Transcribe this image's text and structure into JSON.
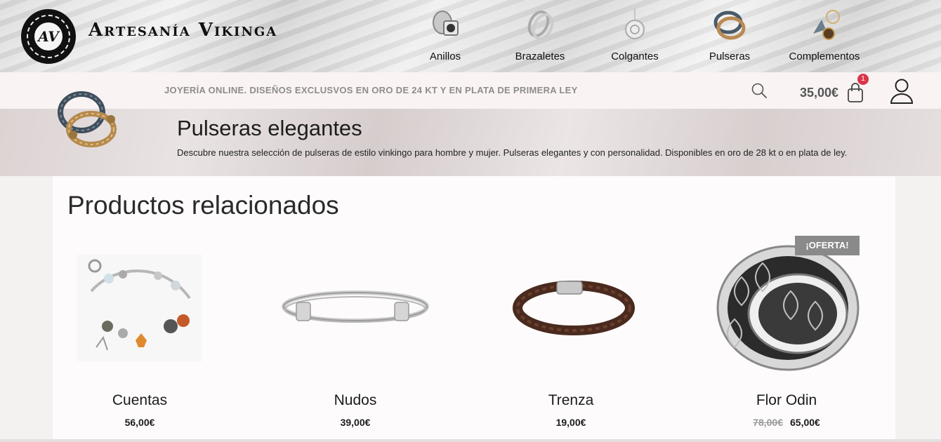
{
  "header": {
    "logo_text": "AV",
    "brand": "Artesanía Vikinga",
    "nav": [
      {
        "label": "Anillos",
        "icon": "ring-icon"
      },
      {
        "label": "Brazaletes",
        "icon": "bangle-icon"
      },
      {
        "label": "Colgantes",
        "icon": "pendant-icon"
      },
      {
        "label": "Pulseras",
        "icon": "bracelet-icon"
      },
      {
        "label": "Complementos",
        "icon": "accessories-icon"
      }
    ]
  },
  "subbar": {
    "tagline": "JOYERÍA ONLINE. DISEÑOS EXCLUSVOS EN ORO DE 24 KT Y EN PLATA DE PRIMERA LEY",
    "cart_total": "35,00€",
    "cart_count": "1"
  },
  "banner": {
    "title": "Pulseras elegantes",
    "description": "Descubre nuestra selección de pulseras de estilo vinkingo para hombre y mujer. Pulseras elegantes y con personalidad. Disponibles en oro de 28 kt o en plata de ley."
  },
  "related": {
    "title": "Productos relacionados",
    "sale_badge": "¡OFERTA!",
    "products": [
      {
        "name": "Cuentas",
        "price": "56,00€",
        "old_price": ""
      },
      {
        "name": "Nudos",
        "price": "39,00€",
        "old_price": ""
      },
      {
        "name": "Trenza",
        "price": "19,00€",
        "old_price": ""
      },
      {
        "name": "Flor Odin",
        "price": "65,00€",
        "old_price": "78,00€"
      }
    ]
  },
  "colors": {
    "badge": "#d9364a",
    "sale": "#8a8a8a",
    "subbar_bg": "#faf3f3"
  }
}
